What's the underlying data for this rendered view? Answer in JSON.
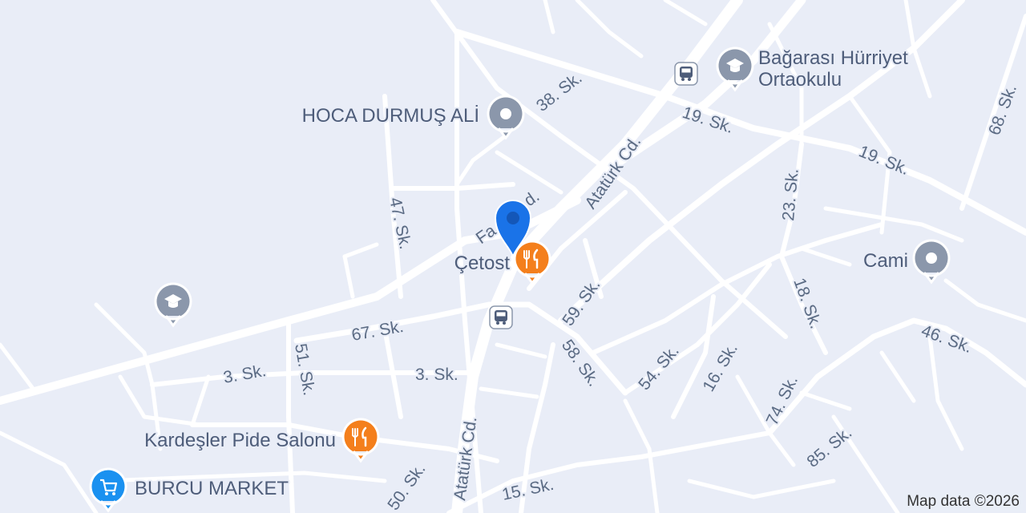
{
  "map": {
    "attribution": "Map data ©2026",
    "colors": {
      "background": "#e9edf7",
      "road": "#ffffff",
      "label": "#5b6b84",
      "poi_gray": "#8b97ab",
      "restaurant": "#f47f1c",
      "shop": "#1a91f0",
      "location_pin": "#1a73e8"
    },
    "streets": [
      {
        "label": "38. Sk."
      },
      {
        "label": "19. Sk."
      },
      {
        "label": "19. Sk."
      },
      {
        "label": "68. Sk."
      },
      {
        "label": "Atatürk Cd."
      },
      {
        "label": "Fa"
      },
      {
        "label": "d."
      },
      {
        "label": "47. Sk."
      },
      {
        "label": "23. Sk."
      },
      {
        "label": "67. Sk."
      },
      {
        "label": "59. Sk."
      },
      {
        "label": "18. Sk."
      },
      {
        "label": "46. Sk."
      },
      {
        "label": "51. Sk."
      },
      {
        "label": "3. Sk."
      },
      {
        "label": "3. Sk."
      },
      {
        "label": "58. Sk."
      },
      {
        "label": "54. Sk."
      },
      {
        "label": "16. Sk."
      },
      {
        "label": "74. Sk."
      },
      {
        "label": "85. Sk."
      },
      {
        "label": "Atatürk Cd."
      },
      {
        "label": "50. Sk."
      },
      {
        "label": "15. Sk."
      }
    ],
    "pois": [
      {
        "name_line1": "Bağarası Hürriyet",
        "name_line2": "Ortaokulu",
        "icon": "school-icon"
      },
      {
        "name": "HOCA DURMUŞ ALİ",
        "icon": "place-icon"
      },
      {
        "name": "Cami",
        "icon": "place-icon"
      },
      {
        "name": "Çetost",
        "icon": "restaurant-icon"
      },
      {
        "name": "Kardeşler Pide Salonu",
        "icon": "restaurant-icon"
      },
      {
        "name": "BURCU MARKET",
        "icon": "shopping-cart-icon"
      }
    ],
    "unnamed_school_icon": "school-icon",
    "bus_stops": [
      {
        "icon": "bus-stop-icon"
      },
      {
        "icon": "bus-stop-icon"
      }
    ],
    "current_location_icon": "location-pin-icon"
  }
}
